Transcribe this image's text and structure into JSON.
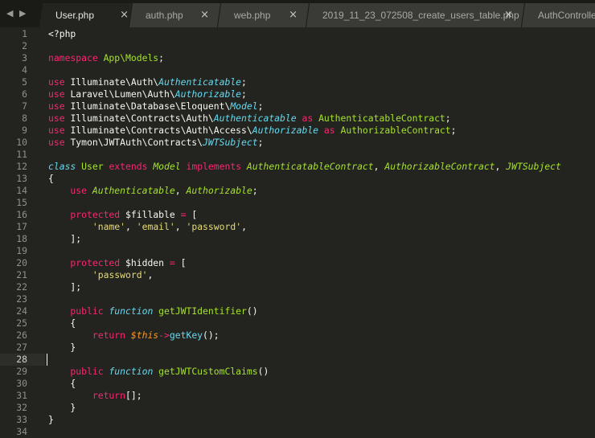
{
  "tabs": [
    {
      "label": "User.php",
      "close": "×",
      "active": true
    },
    {
      "label": "auth.php",
      "close": "×",
      "active": false
    },
    {
      "label": "web.php",
      "close": "×",
      "active": false
    },
    {
      "label": "2019_11_23_072508_create_users_table.php",
      "close": "×",
      "active": false
    },
    {
      "label": "AuthController",
      "close": "",
      "active": false
    }
  ],
  "nav": {
    "arrows": "◀ ▶"
  },
  "editor": {
    "current_line": 28,
    "lines": [
      {
        "n": "1",
        "t": [
          [
            "<?php",
            "w"
          ]
        ]
      },
      {
        "n": "2",
        "t": []
      },
      {
        "n": "3",
        "t": [
          [
            "namespace ",
            "k"
          ],
          [
            "App\\Models",
            "cl"
          ],
          [
            ";",
            "w"
          ]
        ]
      },
      {
        "n": "4",
        "t": []
      },
      {
        "n": "5",
        "t": [
          [
            "use ",
            "k"
          ],
          [
            "Illuminate\\Auth\\",
            "w"
          ],
          [
            "Authenticatable",
            "st"
          ],
          [
            ";",
            "w"
          ]
        ]
      },
      {
        "n": "6",
        "t": [
          [
            "use ",
            "k"
          ],
          [
            "Laravel\\Lumen\\Auth\\",
            "w"
          ],
          [
            "Authorizable",
            "st"
          ],
          [
            ";",
            "w"
          ]
        ]
      },
      {
        "n": "7",
        "t": [
          [
            "use ",
            "k"
          ],
          [
            "Illuminate\\Database\\Eloquent\\",
            "w"
          ],
          [
            "Model",
            "st"
          ],
          [
            ";",
            "w"
          ]
        ]
      },
      {
        "n": "8",
        "t": [
          [
            "use ",
            "k"
          ],
          [
            "Illuminate\\Contracts\\Auth\\",
            "w"
          ],
          [
            "Authenticatable",
            "st"
          ],
          [
            " as ",
            "k"
          ],
          [
            "AuthenticatableContract",
            "cl"
          ],
          [
            ";",
            "w"
          ]
        ]
      },
      {
        "n": "9",
        "t": [
          [
            "use ",
            "k"
          ],
          [
            "Illuminate\\Contracts\\Auth\\Access\\",
            "w"
          ],
          [
            "Authorizable",
            "st"
          ],
          [
            " as ",
            "k"
          ],
          [
            "AuthorizableContract",
            "cl"
          ],
          [
            ";",
            "w"
          ]
        ]
      },
      {
        "n": "10",
        "t": [
          [
            "use ",
            "k"
          ],
          [
            "Tymon\\JWTAuth\\Contracts\\",
            "w"
          ],
          [
            "JWTSubject",
            "st"
          ],
          [
            ";",
            "w"
          ]
        ]
      },
      {
        "n": "11",
        "t": []
      },
      {
        "n": "12",
        "t": [
          [
            "class ",
            "st"
          ],
          [
            "User ",
            "cl"
          ],
          [
            "extends ",
            "k"
          ],
          [
            "Model ",
            "cli"
          ],
          [
            "implements ",
            "k"
          ],
          [
            "AuthenticatableContract",
            "cli"
          ],
          [
            ", ",
            "w"
          ],
          [
            "AuthorizableContract",
            "cli"
          ],
          [
            ", ",
            "w"
          ],
          [
            "JWTSubject",
            "cli"
          ]
        ]
      },
      {
        "n": "13",
        "t": [
          [
            "{",
            "w"
          ]
        ]
      },
      {
        "n": "14",
        "t": [
          [
            "    use ",
            "k"
          ],
          [
            "Authenticatable",
            "cli"
          ],
          [
            ", ",
            "w"
          ],
          [
            "Authorizable",
            "cli"
          ],
          [
            ";",
            "w"
          ]
        ]
      },
      {
        "n": "15",
        "t": []
      },
      {
        "n": "16",
        "t": [
          [
            "    protected ",
            "k"
          ],
          [
            "$fillable ",
            "w"
          ],
          [
            "= ",
            "k"
          ],
          [
            "[",
            "w"
          ]
        ]
      },
      {
        "n": "17",
        "t": [
          [
            "        ",
            "w"
          ],
          [
            "'name'",
            "s"
          ],
          [
            ", ",
            "w"
          ],
          [
            "'email'",
            "s"
          ],
          [
            ", ",
            "w"
          ],
          [
            "'password'",
            "s"
          ],
          [
            ",",
            "w"
          ]
        ]
      },
      {
        "n": "18",
        "t": [
          [
            "    ];",
            "w"
          ]
        ]
      },
      {
        "n": "19",
        "t": []
      },
      {
        "n": "20",
        "t": [
          [
            "    protected ",
            "k"
          ],
          [
            "$hidden ",
            "w"
          ],
          [
            "= ",
            "k"
          ],
          [
            "[",
            "w"
          ]
        ]
      },
      {
        "n": "21",
        "t": [
          [
            "        ",
            "w"
          ],
          [
            "'password'",
            "s"
          ],
          [
            ",",
            "w"
          ]
        ]
      },
      {
        "n": "22",
        "t": [
          [
            "    ];",
            "w"
          ]
        ]
      },
      {
        "n": "23",
        "t": []
      },
      {
        "n": "24",
        "t": [
          [
            "    public ",
            "k"
          ],
          [
            "function ",
            "st"
          ],
          [
            "getJWTIdentifier",
            "f"
          ],
          [
            "()",
            "w"
          ]
        ]
      },
      {
        "n": "25",
        "t": [
          [
            "    {",
            "w"
          ]
        ]
      },
      {
        "n": "26",
        "t": [
          [
            "        return ",
            "k"
          ],
          [
            "$this",
            "v"
          ],
          [
            "->",
            "k"
          ],
          [
            "getKey",
            "fc"
          ],
          [
            "();",
            "w"
          ]
        ]
      },
      {
        "n": "27",
        "t": [
          [
            "    }",
            "w"
          ]
        ]
      },
      {
        "n": "28",
        "t": []
      },
      {
        "n": "29",
        "t": [
          [
            "    public ",
            "k"
          ],
          [
            "function ",
            "st"
          ],
          [
            "getJWTCustomClaims",
            "f"
          ],
          [
            "()",
            "w"
          ]
        ]
      },
      {
        "n": "30",
        "t": [
          [
            "    {",
            "w"
          ]
        ]
      },
      {
        "n": "31",
        "t": [
          [
            "        return",
            "k"
          ],
          [
            "[];",
            "w"
          ]
        ]
      },
      {
        "n": "32",
        "t": [
          [
            "    }",
            "w"
          ]
        ]
      },
      {
        "n": "33",
        "t": [
          [
            "}",
            "w"
          ]
        ]
      },
      {
        "n": "34",
        "t": []
      }
    ]
  }
}
